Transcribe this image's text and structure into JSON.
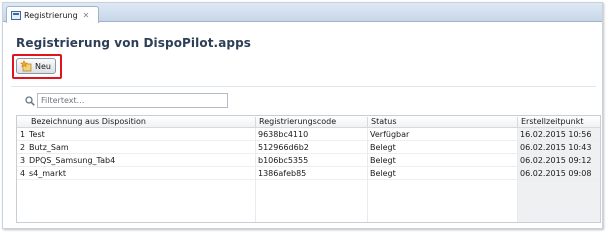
{
  "tab": {
    "label": "Registrierung",
    "close": "✕"
  },
  "page": {
    "title": "Registrierung von DispoPilot.apps"
  },
  "toolbar": {
    "new_label": "Neu"
  },
  "filter": {
    "placeholder": "Filtertext...",
    "value": ""
  },
  "table": {
    "columns": [
      "Bezeichnung aus Disposition",
      "Registrierungscode",
      "Status",
      "Erstellzeitpunkt"
    ],
    "rows": [
      {
        "index": "1",
        "name": "Test",
        "code": "9638bc4110",
        "status": "Verfügbar",
        "created": "16.02.2015 10:56"
      },
      {
        "index": "2",
        "name": "Butz_Sam",
        "code": "512966d6b2",
        "status": "Belegt",
        "created": "06.02.2015 10:43"
      },
      {
        "index": "3",
        "name": "DPQS_Samsung_Tab4",
        "code": "b106bc5355",
        "status": "Belegt",
        "created": "06.02.2015 09:12"
      },
      {
        "index": "4",
        "name": "s4_markt",
        "code": "1386afeb85",
        "status": "Belegt",
        "created": "06.02.2015 09:08"
      }
    ]
  },
  "colors": {
    "highlight": "#e0141c",
    "title": "#2d3f57",
    "tabstrip": "#c7d6e8"
  },
  "icons": {
    "tab": "registration-icon",
    "new": "star-new-icon",
    "filter": "search-icon"
  }
}
